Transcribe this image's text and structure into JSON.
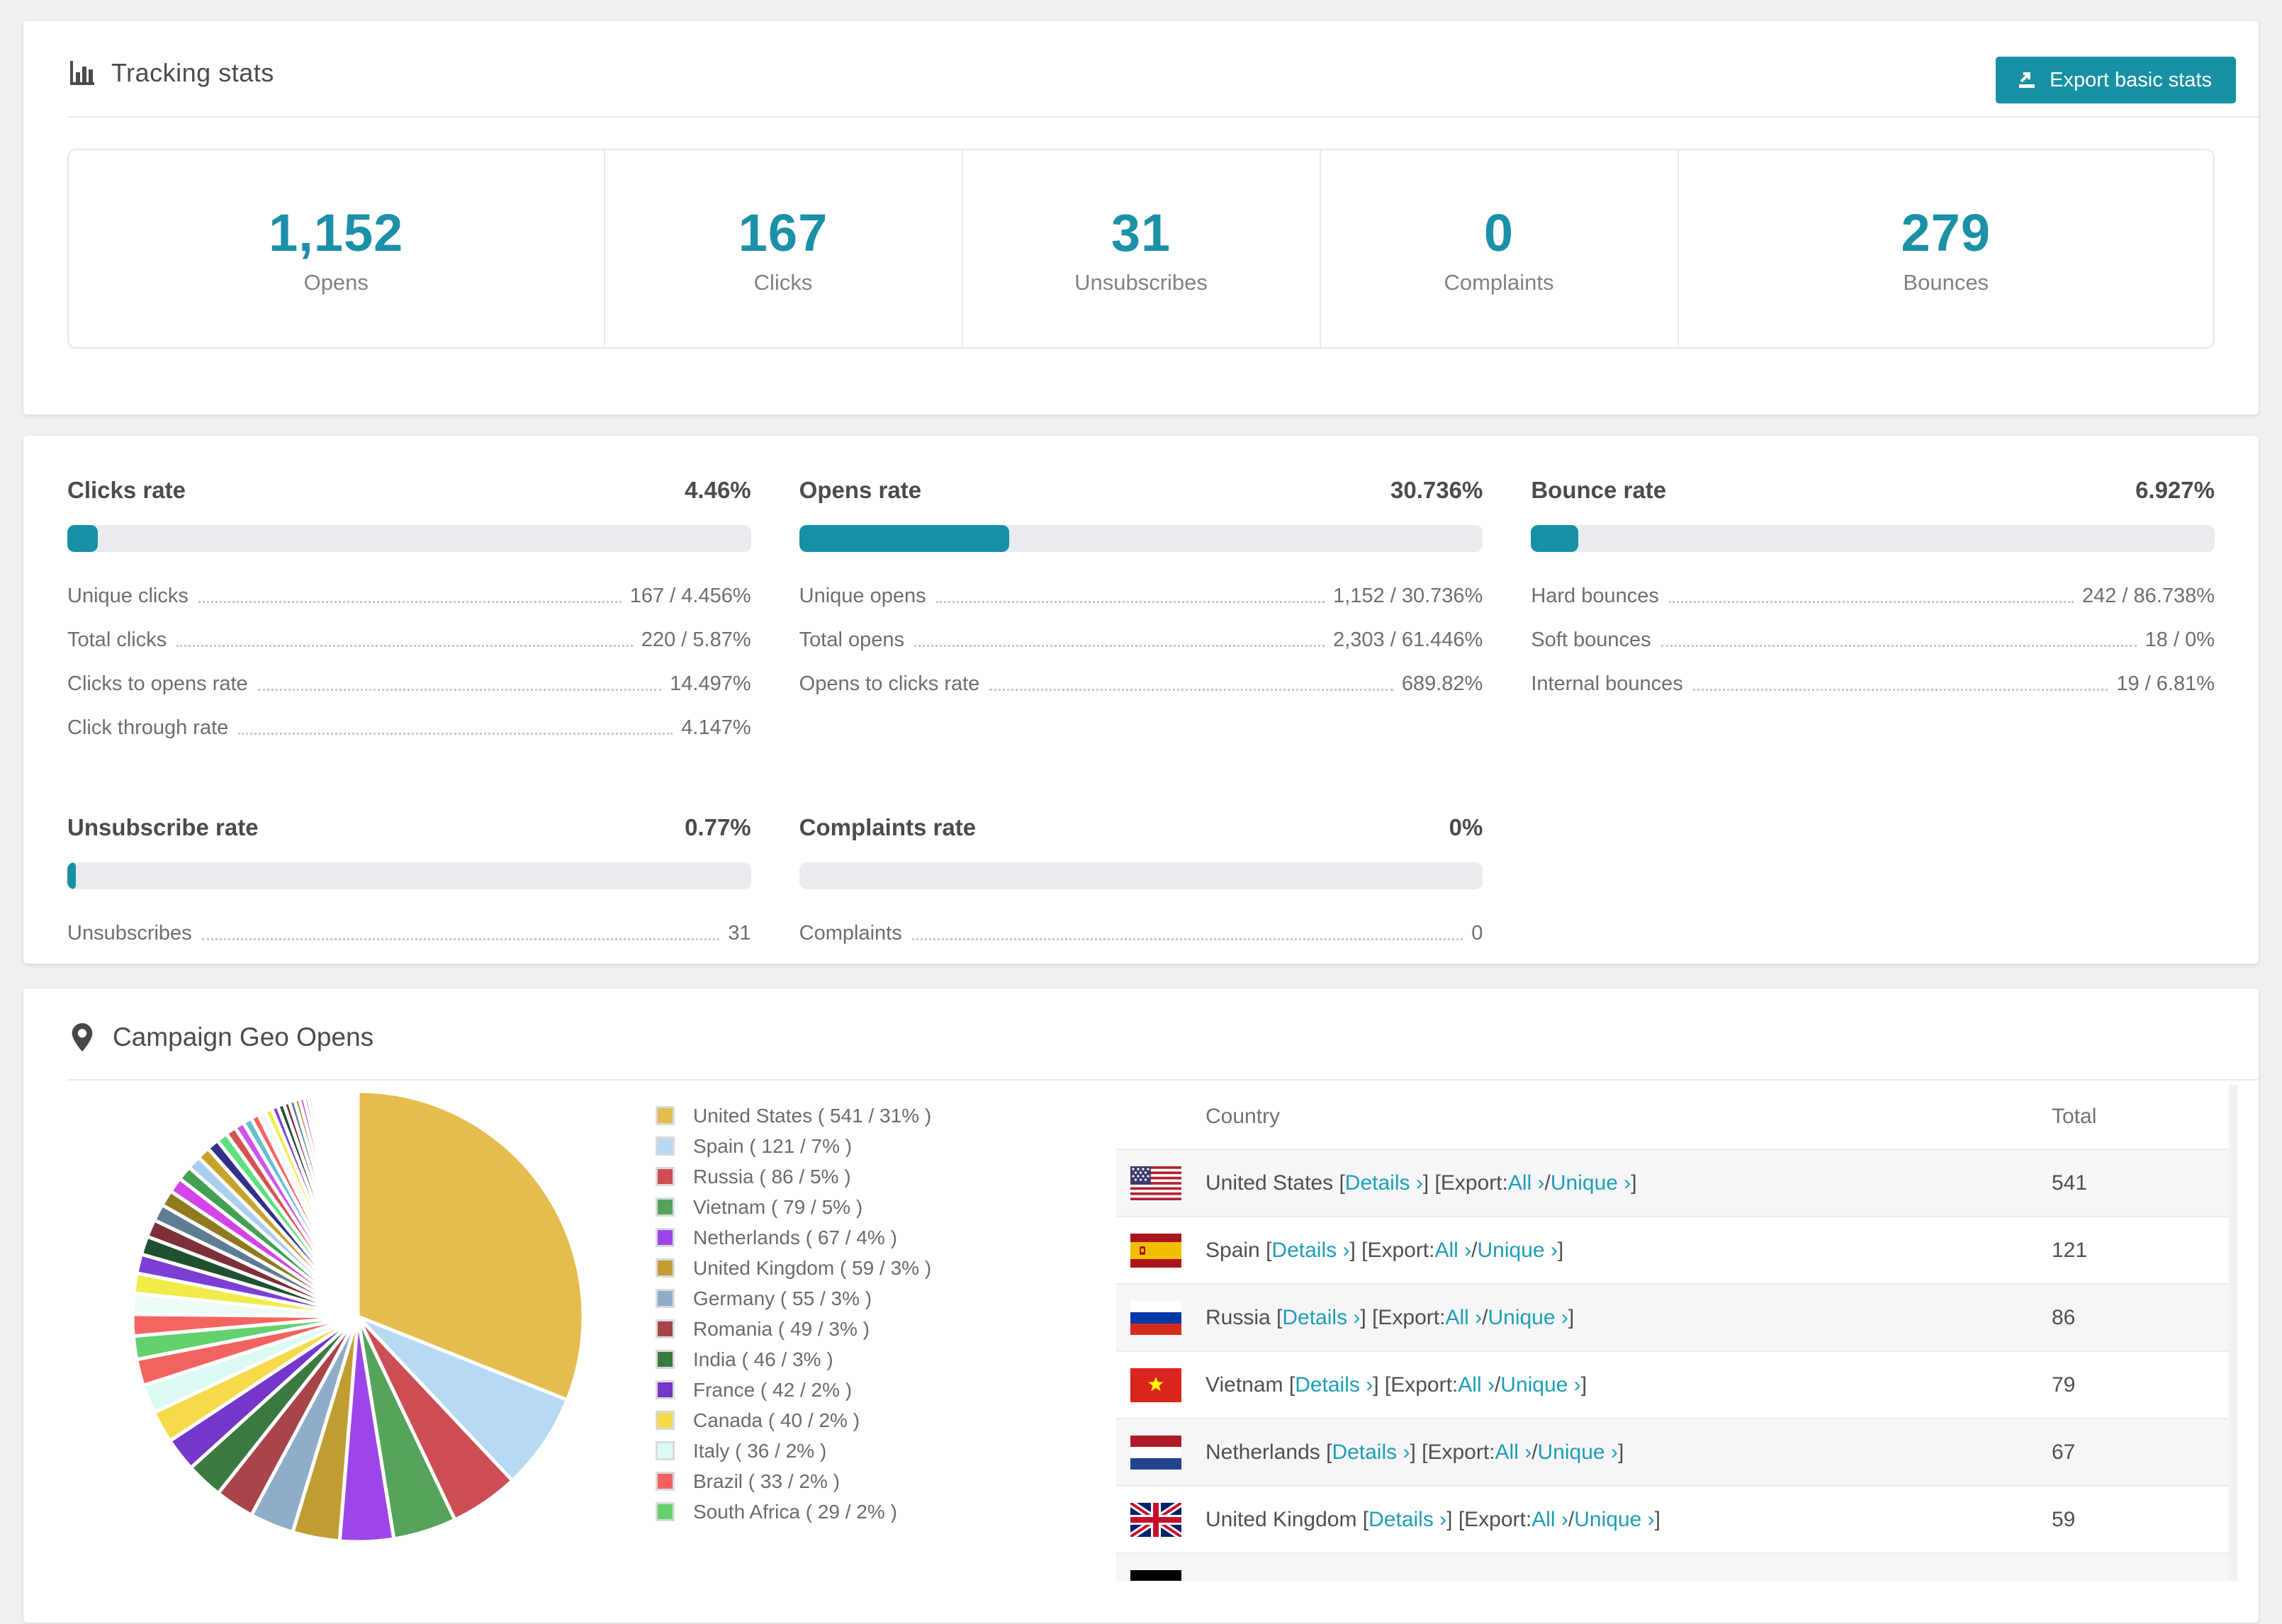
{
  "accent": "#1790a4",
  "tracking": {
    "title": "Tracking stats",
    "export_button": "Export basic stats",
    "stats": [
      {
        "value": "1,152",
        "label": "Opens"
      },
      {
        "value": "167",
        "label": "Clicks"
      },
      {
        "value": "31",
        "label": "Unsubscribes"
      },
      {
        "value": "0",
        "label": "Complaints"
      },
      {
        "value": "279",
        "label": "Bounces"
      }
    ]
  },
  "rates": {
    "panels": [
      {
        "title": "Clicks rate",
        "value": "4.46%",
        "bar_pct": 4.46,
        "rows": [
          {
            "label": "Unique clicks",
            "value": "167 / 4.456%"
          },
          {
            "label": "Total clicks",
            "value": "220 / 5.87%"
          },
          {
            "label": "Clicks to opens rate",
            "value": "14.497%"
          },
          {
            "label": "Click through rate",
            "value": "4.147%"
          }
        ]
      },
      {
        "title": "Opens rate",
        "value": "30.736%",
        "bar_pct": 30.736,
        "rows": [
          {
            "label": "Unique opens",
            "value": "1,152 / 30.736%"
          },
          {
            "label": "Total opens",
            "value": "2,303 / 61.446%"
          },
          {
            "label": "Opens to clicks rate",
            "value": "689.82%"
          }
        ]
      },
      {
        "title": "Bounce rate",
        "value": "6.927%",
        "bar_pct": 6.927,
        "rows": [
          {
            "label": "Hard bounces",
            "value": "242 / 86.738%"
          },
          {
            "label": "Soft bounces",
            "value": "18 / 0%"
          },
          {
            "label": "Internal bounces",
            "value": "19 / 6.81%"
          }
        ]
      },
      {
        "title": "Unsubscribe rate",
        "value": "0.77%",
        "bar_pct": 0.77,
        "rows": [
          {
            "label": "Unsubscribes",
            "value": "31"
          }
        ]
      },
      {
        "title": "Complaints rate",
        "value": "0%",
        "bar_pct": 0,
        "rows": [
          {
            "label": "Complaints",
            "value": "0"
          }
        ]
      }
    ]
  },
  "geo": {
    "title": "Campaign Geo Opens",
    "table": {
      "country_header": "Country",
      "total_header": "Total",
      "link_details": "Details ›",
      "export_prefix": "Export:",
      "link_all": "All ›",
      "link_unique": "Unique ›",
      "bracket_open": "[",
      "bracket_close": "]",
      "slash": "/",
      "rows": [
        {
          "flag": "us",
          "country": "United States",
          "total": "541",
          "stripe": true
        },
        {
          "flag": "es",
          "country": "Spain",
          "total": "121",
          "stripe": false
        },
        {
          "flag": "ru",
          "country": "Russia",
          "total": "86",
          "stripe": true
        },
        {
          "flag": "vn",
          "country": "Vietnam",
          "total": "79",
          "stripe": false
        },
        {
          "flag": "nl",
          "country": "Netherlands",
          "total": "67",
          "stripe": true
        },
        {
          "flag": "gb",
          "country": "United Kingdom",
          "total": "59",
          "stripe": false
        },
        {
          "flag": "de",
          "country": "",
          "total": "",
          "stripe": true,
          "partial": true
        }
      ]
    }
  },
  "chart_data": {
    "type": "pie",
    "title": "Campaign Geo Opens",
    "legend_position": "right-of-pie",
    "start_angle_deg": -90,
    "direction": "clockwise",
    "slices": [
      {
        "name": "United States",
        "value": 541,
        "pct": "31",
        "color": "#e3bc4d"
      },
      {
        "name": "Spain",
        "value": 121,
        "pct": "7",
        "color": "#b7d9f2"
      },
      {
        "name": "Russia",
        "value": 86,
        "pct": "5",
        "color": "#cc4e54"
      },
      {
        "name": "Vietnam",
        "value": 79,
        "pct": "5",
        "color": "#56a35c"
      },
      {
        "name": "Netherlands",
        "value": 67,
        "pct": "4",
        "color": "#9c45e8"
      },
      {
        "name": "United Kingdom",
        "value": 59,
        "pct": "3",
        "color": "#c09d33"
      },
      {
        "name": "Germany",
        "value": 55,
        "pct": "3",
        "color": "#8fadc6"
      },
      {
        "name": "Romania",
        "value": 49,
        "pct": "3",
        "color": "#a8454b"
      },
      {
        "name": "India",
        "value": 46,
        "pct": "3",
        "color": "#3a7a40"
      },
      {
        "name": "France",
        "value": 42,
        "pct": "2",
        "color": "#7536c9"
      },
      {
        "name": "Canada",
        "value": 40,
        "pct": "2",
        "color": "#f6da4a"
      },
      {
        "name": "Italy",
        "value": 36,
        "pct": "2",
        "color": "#dcfaf4"
      },
      {
        "name": "Brazil",
        "value": 33,
        "pct": "2",
        "color": "#f2635f"
      },
      {
        "name": "South Africa",
        "value": 29,
        "pct": "2",
        "color": "#63d16e"
      }
    ],
    "legend_format": "{name} ( {value} / {pct}% )",
    "others": {
      "values": [
        27,
        26,
        25,
        24,
        23,
        22,
        21,
        20,
        19,
        18,
        17,
        16,
        15,
        14,
        13,
        12,
        11,
        10,
        9,
        9,
        8,
        8,
        7,
        7,
        6,
        6,
        5,
        5,
        4,
        4,
        3,
        3,
        3,
        2,
        2,
        2,
        2,
        2,
        2,
        2,
        2,
        2,
        2,
        2,
        2,
        2,
        1,
        1,
        1,
        1,
        1,
        1,
        1,
        1,
        1,
        1,
        1,
        1,
        1,
        1
      ],
      "palette": [
        "#f4655f",
        "#eefaf8",
        "#f1ec4a",
        "#7b3fd6",
        "#1f5130",
        "#7c3037",
        "#5e7d92",
        "#8f7a1f",
        "#d643e8",
        "#43a052",
        "#aacfee",
        "#c7a22b",
        "#34308a",
        "#5ee07d",
        "#d65252",
        "#cf54e8",
        "#62c0d0"
      ]
    }
  }
}
